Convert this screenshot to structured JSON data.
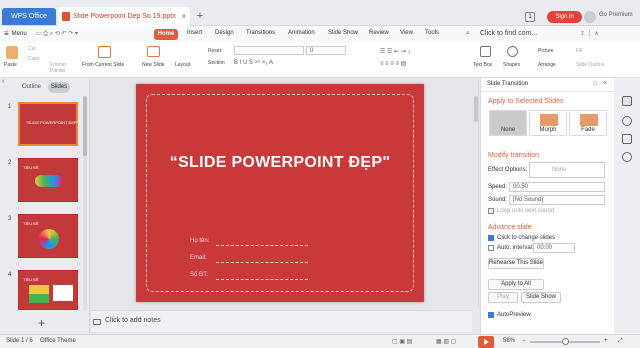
{
  "app": {
    "name": "WPS Office",
    "doc_tab": "Slide Powerpoint Dep So 19.pptx",
    "badge": "1",
    "sign_in": "Sign in",
    "go_premium": "Go Premium"
  },
  "menu": {
    "menu_label": "Menu",
    "tabs": [
      "Home",
      "Insert",
      "Design",
      "Transitions",
      "Animation",
      "Slide Show",
      "Review",
      "View",
      "Tools"
    ],
    "find": "Click to find com..."
  },
  "ribbon": {
    "paste": "Paste",
    "cut": "Cut",
    "copy": "Copy",
    "format_painter": "Format Painter",
    "from_current_slide": "From Current Slide",
    "new_slide": "New Slide",
    "layout": "Layout",
    "reset": "Reset",
    "section": "Section",
    "font_size": "0",
    "text_box": "Text Box",
    "shapes": "Shapes",
    "picture": "Picture",
    "arrange": "Arrange",
    "fill": "Fill",
    "slide_outline": "Slide Outline"
  },
  "left_panel": {
    "outline": "Outline",
    "slides": "Slides",
    "thumb_title": "\"SLIDE POWERPOINT ĐẸP\"",
    "thumb_label": "TIÊU ĐỀ",
    "slide_numbers": [
      "1",
      "2",
      "3",
      "4"
    ]
  },
  "slide": {
    "title": "“SLIDE POWERPOINT ĐẸP\"",
    "fields": [
      "Họ tên:",
      "Email:",
      "Số ĐT:"
    ]
  },
  "notes": {
    "placeholder": "Click to add notes"
  },
  "transition_panel": {
    "title": "Slide Transition",
    "apply_selected": "Apply to Selected Slides",
    "transitions": [
      "None",
      "Morph",
      "Fade"
    ],
    "modify": "Modify transition",
    "effect_options_label": "Effect Options:",
    "effect_options_value": "None",
    "speed_label": "Speed:",
    "speed_value": "00.50",
    "sound_label": "Sound:",
    "sound_value": "[No Sound]",
    "loop": "Loop until next sound",
    "advance": "Advance slide",
    "click_change": "Click to change slides",
    "auto_interval": "Auto, interval:",
    "interval_value": "00:00",
    "rehearse": "Rehearse This Slide",
    "apply_all": "Apply to All",
    "play": "Play",
    "slide_show": "Slide Show",
    "autopreview": "AutoPreview"
  },
  "status": {
    "slide_info": "Slide 1 / 6",
    "theme": "Office Theme",
    "zoom": "58%"
  }
}
